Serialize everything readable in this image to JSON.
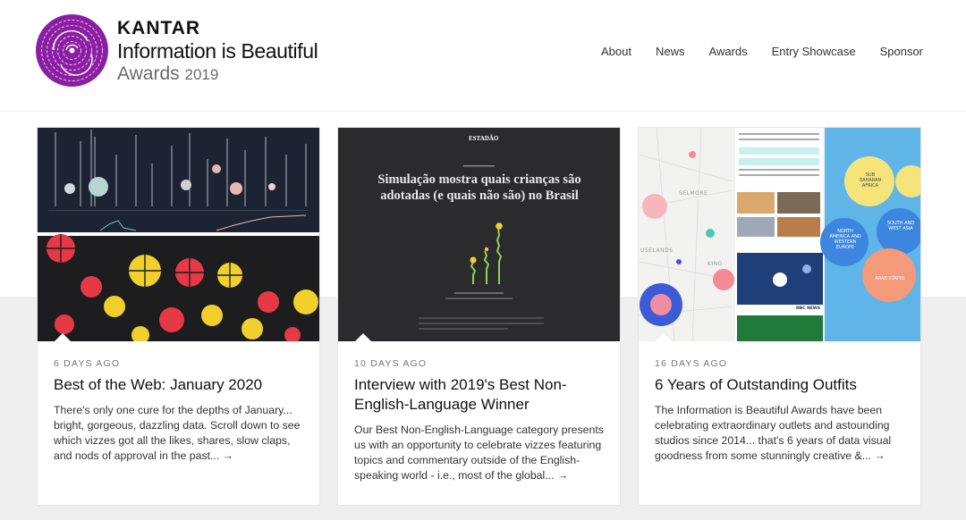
{
  "header": {
    "brand": {
      "company": "KANTAR",
      "title": "Information is Beautiful",
      "awards": "Awards",
      "year": "2019"
    },
    "nav": [
      "About",
      "News",
      "Awards",
      "Entry Showcase",
      "Sponsor"
    ]
  },
  "cards": [
    {
      "meta": "6 DAYS AGO",
      "title": "Best of the Web: January 2020",
      "excerpt": "There's only one cure for the depths of January... bright, gorgeous, dazzling data. Scroll down to see which vizzes got all the likes, shares, slow claps, and nods of approval in the past... →"
    },
    {
      "meta": "10 DAYS AGO",
      "title": "Interview with 2019's Best Non-English-Language Winner",
      "excerpt": "Our Best Non-English-Language category presents us with an opportunity to celebrate vizzes featuring topics and commentary outside of the English-speaking world - i.e., most of the global... →",
      "thumb": {
        "masthead": "ESTADÃO",
        "headline_line1": "Simulação mostra quais crianças são",
        "headline_line2": "adotadas (e quais não são) no Brasil"
      }
    },
    {
      "meta": "16 DAYS AGO",
      "title": "6 Years of Outstanding Outfits",
      "excerpt": "The Information is Beautiful Awards have been celebrating extraordinary outlets and astounding studios since 2014... that's 6 years of data visual goodness from some stunningly creative &... →",
      "thumb": {
        "map_labels": [
          "SELMORE",
          "USELANDS",
          "KING"
        ],
        "bubble_labels": [
          "SUB SAHARAN AFRICA",
          "NORTH AMERICA AND WESTERN EUROPE",
          "SOUTH AND WEST ASIA",
          "ARAB STATES"
        ],
        "news_label": "NBC NEWS"
      }
    }
  ],
  "colors": {
    "logo_purple": "#8b1fa3",
    "background_band": "#efefef",
    "dark_thumb": "#2b2b2e"
  }
}
